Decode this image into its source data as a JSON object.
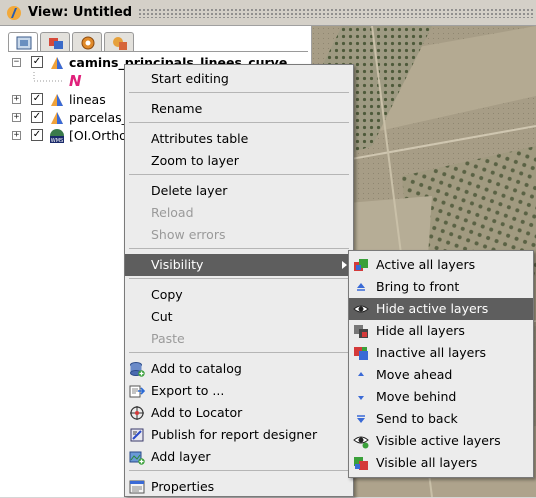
{
  "window": {
    "title": "View: Untitled"
  },
  "toc": {
    "tabs": [
      "layers-tab",
      "sources-tab",
      "selection-tab",
      "overlay-tab"
    ],
    "layers": [
      {
        "name": "camins_principals_linees_curve",
        "expanded": true,
        "checked": true,
        "bold": true
      },
      {
        "name": "N",
        "legend": true
      },
      {
        "name": "lineas",
        "expanded": false,
        "checked": true
      },
      {
        "name": "parcelas_",
        "expanded": false,
        "checked": true
      },
      {
        "name": "[OI.Ortho",
        "expanded": false,
        "checked": true
      }
    ]
  },
  "context_menu": {
    "items": [
      {
        "label": "Start editing",
        "enabled": true
      },
      {
        "label": "Rename",
        "enabled": true
      },
      {
        "label": "Attributes table",
        "enabled": true
      },
      {
        "label": "Zoom to layer",
        "enabled": true
      },
      {
        "label": "Delete layer",
        "enabled": true
      },
      {
        "label": "Reload",
        "enabled": false
      },
      {
        "label": "Show errors",
        "enabled": false
      },
      {
        "label": "Visibility",
        "enabled": true,
        "submenu": true,
        "highlighted": true
      },
      {
        "label": "Copy",
        "enabled": true
      },
      {
        "label": "Cut",
        "enabled": true
      },
      {
        "label": "Paste",
        "enabled": false
      },
      {
        "label": "Add to catalog",
        "enabled": true,
        "icon": "database-add-icon"
      },
      {
        "label": "Export to ...",
        "enabled": true,
        "icon": "export-icon"
      },
      {
        "label": "Add to Locator",
        "enabled": true,
        "icon": "locator-icon"
      },
      {
        "label": "Publish for report designer",
        "enabled": true,
        "icon": "publish-icon"
      },
      {
        "label": "Add layer",
        "enabled": true,
        "icon": "add-layer-icon"
      },
      {
        "label": "Properties",
        "enabled": true,
        "icon": "properties-icon"
      }
    ]
  },
  "visibility_submenu": {
    "items": [
      {
        "label": "Active all layers",
        "icon": "layers-active-icon"
      },
      {
        "label": "Bring to front",
        "icon": "bring-front-icon"
      },
      {
        "label": "Hide active layers",
        "icon": "eye-hide-icon",
        "highlighted": true
      },
      {
        "label": "Hide all layers",
        "icon": "layers-hide-icon"
      },
      {
        "label": "Inactive all layers",
        "icon": "layers-inactive-icon"
      },
      {
        "label": "Move ahead",
        "icon": "move-ahead-icon"
      },
      {
        "label": "Move behind",
        "icon": "move-behind-icon"
      },
      {
        "label": "Send to back",
        "icon": "send-back-icon"
      },
      {
        "label": "Visible active layers",
        "icon": "eye-visible-icon"
      },
      {
        "label": "Visible all layers",
        "icon": "layers-visible-icon"
      }
    ]
  },
  "colors": {
    "highlight": "#5e5e5e",
    "menu_bg": "#ececec",
    "disabled_text": "#9a9a9a"
  }
}
